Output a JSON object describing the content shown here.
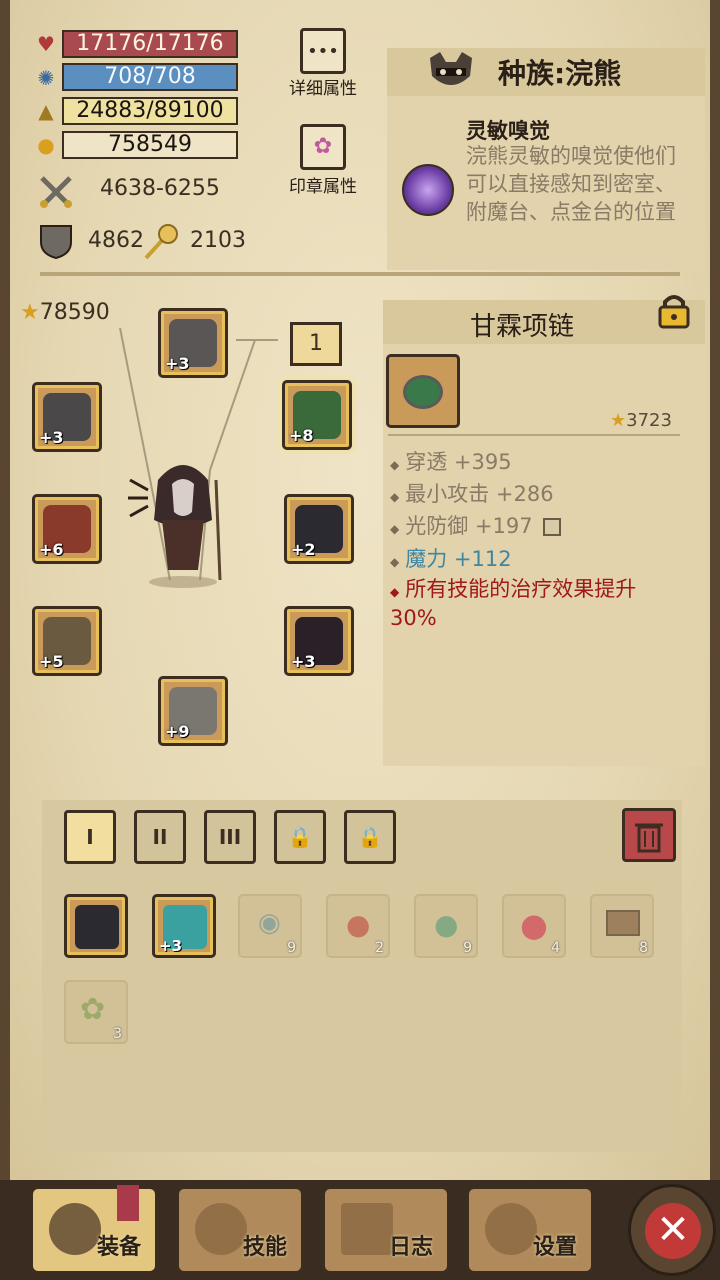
{
  "stats": {
    "hp": "17176/17176",
    "mp": "708/708",
    "xp": "24883/89100",
    "gold": "758549",
    "attack": "4638-6255",
    "defense": "4862",
    "gems": "2103",
    "power": "78590"
  },
  "buttons": {
    "detail_attrs": "详细属性",
    "seal_attrs": "印章属性"
  },
  "race": {
    "title": "种族:浣熊",
    "skill_name": "灵敏嗅觉",
    "skill_desc": "浣熊灵敏的嗅觉使他们可以直接感知到密室、附魔台、点金台的位置"
  },
  "equipment": {
    "slot_number": "1",
    "slots": [
      {
        "name": "helmet",
        "level": "+3"
      },
      {
        "name": "gauntlet",
        "level": "+3"
      },
      {
        "name": "necklace",
        "level": "+8"
      },
      {
        "name": "weapon",
        "level": "+6"
      },
      {
        "name": "chest-armor",
        "level": "+2"
      },
      {
        "name": "bracer",
        "level": "+5"
      },
      {
        "name": "belt",
        "level": "+3"
      },
      {
        "name": "boots",
        "level": "+9"
      }
    ]
  },
  "item": {
    "title": "甘霖项链",
    "score": "3723",
    "attrs": [
      {
        "text": "穿透 +395",
        "color": "normal"
      },
      {
        "text": "最小攻击 +286",
        "color": "normal"
      },
      {
        "text": "光防御 +197",
        "color": "normal"
      },
      {
        "text": "魔力 +112",
        "color": "blue"
      },
      {
        "text": "所有技能的治疗效果提升30%",
        "color": "red"
      }
    ]
  },
  "inventory": {
    "tabs": [
      "I",
      "II",
      "III"
    ],
    "items": [
      {
        "name": "dark-armor",
        "level": ""
      },
      {
        "name": "crystal-amulet",
        "level": "+3"
      },
      {
        "name": "eye-scroll",
        "count": "9"
      },
      {
        "name": "red-potion-small",
        "count": "2"
      },
      {
        "name": "green-potion",
        "count": "9"
      },
      {
        "name": "red-potion-large",
        "count": "4"
      },
      {
        "name": "treasure-chest",
        "count": "8"
      },
      {
        "name": "herb-bush",
        "count": "3"
      }
    ]
  },
  "nav": {
    "equip": "装备",
    "skills": "技能",
    "log": "日志",
    "settings": "设置"
  },
  "colors": {
    "hp": "#a94a4e",
    "mp": "#5a8fbf",
    "xp": "#efe1a0",
    "effect_red": "#a01818",
    "magic_blue": "#3f86a0"
  }
}
